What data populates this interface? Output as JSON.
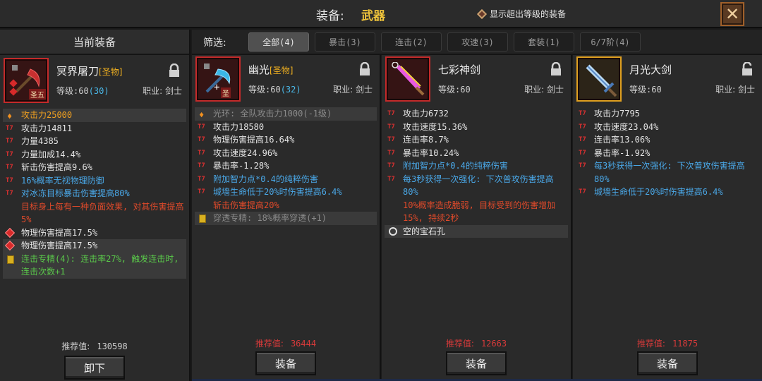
{
  "header": {
    "title": "装备:",
    "category": "武器",
    "show_over_level_label": "显示超出等级的装备"
  },
  "current": {
    "panel_title": "当前装备",
    "name": "冥界屠刀",
    "tag": "[圣物]",
    "badge": "圣五",
    "level_text": "等级:60",
    "level_bonus": "(30)",
    "job": "职业: 剑士",
    "stats": [
      {
        "text": "攻击力25000",
        "cls": "gold-txt hl",
        "icon": "flame"
      },
      {
        "text": "攻击力14811",
        "cls": "",
        "icon": "t7"
      },
      {
        "text": "力量4385",
        "cls": "",
        "icon": "t7"
      },
      {
        "text": "力量加成14.4%",
        "cls": "",
        "icon": "t7"
      },
      {
        "text": "斩击伤害提高9.6%",
        "cls": "",
        "icon": "t7"
      },
      {
        "text": "16%概率无视物理防御",
        "cls": "blue",
        "icon": "t7"
      },
      {
        "text": "对冰冻目标暴击伤害提高80%",
        "cls": "blue",
        "icon": "t7"
      },
      {
        "text": "目标身上每有一种负面效果, 对其伤害提高5%",
        "cls": "red",
        "icon": "none"
      },
      {
        "text": "物理伤害提高17.5%",
        "cls": "",
        "icon": "gem"
      },
      {
        "text": "物理伤害提高17.5%",
        "cls": "hl",
        "icon": "gem"
      },
      {
        "text": "连击专精(4): 连击率27%, 触发连击时, 连击次数+1",
        "cls": "green hl",
        "icon": "scroll"
      }
    ],
    "recommend_label": "推荐值:",
    "recommend_value": "130598",
    "button": "卸下"
  },
  "filter": {
    "label": "筛选:",
    "tabs": [
      "全部(4)",
      "暴击(3)",
      "连击(2)",
      "攻速(3)",
      "套装(1)",
      "6/7阶(4)"
    ]
  },
  "items": [
    {
      "name": "幽光",
      "tag": "[圣物]",
      "badge": "圣",
      "level_text": "等级:60",
      "level_bonus": "(32)",
      "job": "职业: 剑士",
      "stats": [
        {
          "text": "光环: 全队攻击力1000(-1级)",
          "cls": "gray hl",
          "icon": "flame"
        },
        {
          "text": "攻击力18580",
          "cls": "",
          "icon": "t7"
        },
        {
          "text": "物理伤害提高16.64%",
          "cls": "",
          "icon": "t7"
        },
        {
          "text": "攻击速度24.96%",
          "cls": "",
          "icon": "t7"
        },
        {
          "text": "暴击率-1.28%",
          "cls": "",
          "icon": "t7"
        },
        {
          "text": "附加智力点*0.4的纯粹伤害",
          "cls": "blue",
          "icon": "t7"
        },
        {
          "text": "城墙生命低于20%时伤害提高6.4%",
          "cls": "blue",
          "icon": "t7"
        },
        {
          "text": "斩击伤害提高20%",
          "cls": "red",
          "icon": "none"
        },
        {
          "text": "穿透专精: 18%概率穿透(+1)",
          "cls": "gray hl",
          "icon": "scroll"
        }
      ],
      "recommend_label": "推荐值:",
      "recommend_value": "36444",
      "button": "装备"
    },
    {
      "name": "七彩神剑",
      "level_text": "等级:60",
      "job": "职业: 剑士",
      "stats": [
        {
          "text": "攻击力6732",
          "cls": "",
          "icon": "t7"
        },
        {
          "text": "攻击速度15.36%",
          "cls": "",
          "icon": "t7"
        },
        {
          "text": "连击率8.7%",
          "cls": "",
          "icon": "t7"
        },
        {
          "text": "暴击率10.24%",
          "cls": "",
          "icon": "t7"
        },
        {
          "text": "附加智力点*0.4的纯粹伤害",
          "cls": "blue",
          "icon": "t7"
        },
        {
          "text": "每3秒获得一次强化: 下次普攻伤害提高80%",
          "cls": "blue",
          "icon": "t7"
        },
        {
          "text": "10%概率造成脆弱, 目标受到的伤害增加15%, 持续2秒",
          "cls": "red",
          "icon": "none"
        },
        {
          "text": "空的宝石孔",
          "cls": "hl",
          "icon": "socket"
        }
      ],
      "recommend_label": "推荐值:",
      "recommend_value": "12663",
      "button": "装备"
    },
    {
      "name": "月光大剑",
      "level_text": "等级:60",
      "job": "职业: 剑士",
      "stats": [
        {
          "text": "攻击力7795",
          "cls": "",
          "icon": "t7"
        },
        {
          "text": "攻击速度23.04%",
          "cls": "",
          "icon": "t7"
        },
        {
          "text": "连击率13.06%",
          "cls": "",
          "icon": "t7"
        },
        {
          "text": "暴击率-1.92%",
          "cls": "",
          "icon": "t7"
        },
        {
          "text": "每3秒获得一次强化: 下次普攻伤害提高80%",
          "cls": "blue",
          "icon": "t7"
        },
        {
          "text": "城墙生命低于20%时伤害提高6.4%",
          "cls": "blue",
          "icon": "t7"
        }
      ],
      "recommend_label": "推荐值:",
      "recommend_value": "11875",
      "button": "装备"
    }
  ],
  "tier_prefix": "T7",
  "colors": {
    "accent": "#f0c43b",
    "relic_tag": "#f0b020",
    "stat_blue": "#4aa8e8",
    "stat_red": "#e04a2a",
    "stat_green": "#5ac84a",
    "recommend_red": "#d83a3a"
  }
}
